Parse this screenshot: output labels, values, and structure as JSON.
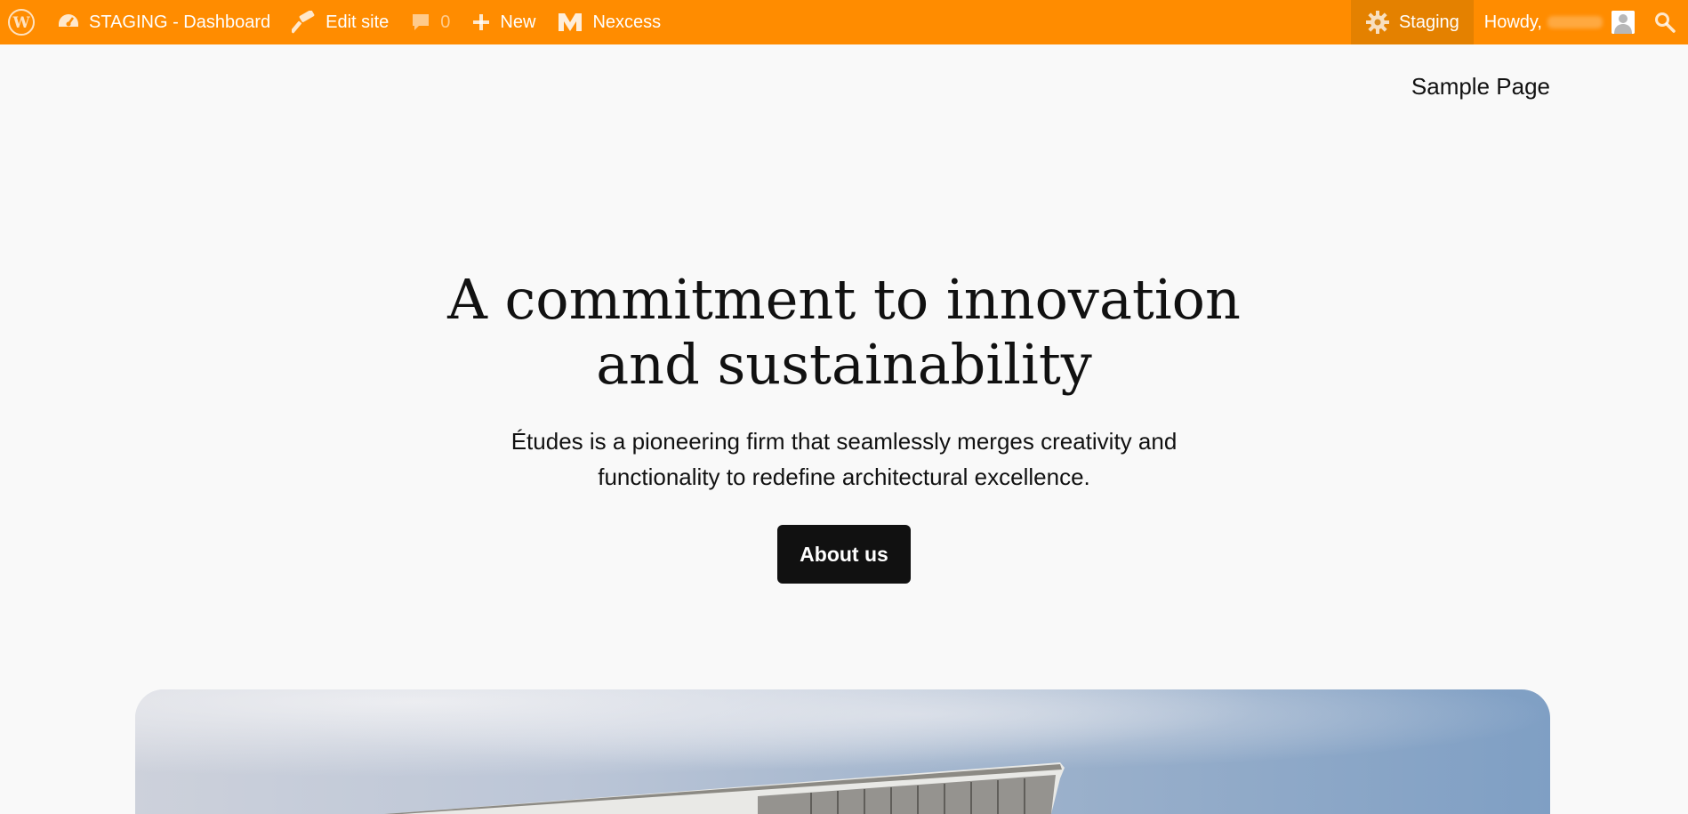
{
  "adminbar": {
    "site_name": "STAGING - Dashboard",
    "edit_site": "Edit site",
    "comments_count": "0",
    "new_label": "New",
    "nexcess_label": "Nexcess",
    "staging_label": "Staging",
    "howdy": "Howdy,",
    "icons": {
      "wordpress": "wordpress-logo-icon",
      "dashboard": "dashboard-gauge-icon",
      "edit": "hammer-icon",
      "comments": "comment-bubble-icon",
      "new": "plus-icon",
      "nexcess": "nexcess-logo-icon",
      "staging": "gear-icon",
      "search": "search-icon"
    },
    "colors": {
      "bar": "#ff8c00",
      "text": "#ffffff"
    }
  },
  "nav": {
    "sample_page": "Sample Page"
  },
  "hero": {
    "title": "A commitment to innovation and sustainability",
    "description": "Études is a pioneering firm that seamlessly merges creativity and functionality to redefine architectural excellence.",
    "button_label": "About us",
    "button_color": "#111111"
  },
  "page": {
    "background": "#f9f9f9"
  }
}
